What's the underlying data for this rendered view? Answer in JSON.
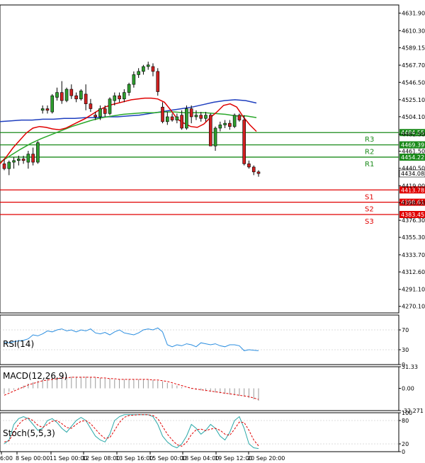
{
  "chart_data": {
    "type": "candlestick",
    "main": {
      "y_range": [
        4262,
        4642
      ],
      "ticks": [
        "4631.90",
        "4610.30",
        "4589.15",
        "4567.70",
        "4546.50",
        "4525.10",
        "4504.10",
        "4482.50",
        "4461.50",
        "4440.50",
        "4419.00",
        "4398.00",
        "4376.30",
        "4355.30",
        "4333.70",
        "4312.60",
        "4291.10",
        "4270.10"
      ],
      "candles": [
        {
          "o": 4446,
          "h": 4452,
          "l": 4438,
          "c": 4440
        },
        {
          "o": 4440,
          "h": 4450,
          "l": 4432,
          "c": 4448
        },
        {
          "o": 4448,
          "h": 4454,
          "l": 4440,
          "c": 4450
        },
        {
          "o": 4450,
          "h": 4456,
          "l": 4444,
          "c": 4452
        },
        {
          "o": 4452,
          "h": 4456,
          "l": 4446,
          "c": 4450
        },
        {
          "o": 4448,
          "h": 4462,
          "l": 4440,
          "c": 4458
        },
        {
          "o": 4458,
          "h": 4466,
          "l": 4444,
          "c": 4448
        },
        {
          "o": 4448,
          "h": 4474,
          "l": 4446,
          "c": 4472
        },
        {
          "o": 4512,
          "h": 4518,
          "l": 4508,
          "c": 4514
        },
        {
          "o": 4514,
          "h": 4518,
          "l": 4508,
          "c": 4512
        },
        {
          "o": 4510,
          "h": 4532,
          "l": 4508,
          "c": 4530
        },
        {
          "o": 4528,
          "h": 4540,
          "l": 4524,
          "c": 4534
        },
        {
          "o": 4534,
          "h": 4548,
          "l": 4520,
          "c": 4524
        },
        {
          "o": 4524,
          "h": 4540,
          "l": 4522,
          "c": 4538
        },
        {
          "o": 4538,
          "h": 4544,
          "l": 4526,
          "c": 4530
        },
        {
          "o": 4530,
          "h": 4534,
          "l": 4522,
          "c": 4526
        },
        {
          "o": 4526,
          "h": 4538,
          "l": 4524,
          "c": 4536
        },
        {
          "o": 4532,
          "h": 4544,
          "l": 4512,
          "c": 4520
        },
        {
          "o": 4520,
          "h": 4526,
          "l": 4510,
          "c": 4514
        },
        {
          "o": 4506,
          "h": 4510,
          "l": 4500,
          "c": 4504
        },
        {
          "o": 4504,
          "h": 4518,
          "l": 4500,
          "c": 4514
        },
        {
          "o": 4514,
          "h": 4518,
          "l": 4504,
          "c": 4508
        },
        {
          "o": 4508,
          "h": 4528,
          "l": 4506,
          "c": 4526
        },
        {
          "o": 4524,
          "h": 4534,
          "l": 4518,
          "c": 4530
        },
        {
          "o": 4530,
          "h": 4534,
          "l": 4522,
          "c": 4526
        },
        {
          "o": 4526,
          "h": 4538,
          "l": 4522,
          "c": 4534
        },
        {
          "o": 4534,
          "h": 4546,
          "l": 4530,
          "c": 4544
        },
        {
          "o": 4544,
          "h": 4560,
          "l": 4540,
          "c": 4556
        },
        {
          "o": 4556,
          "h": 4564,
          "l": 4552,
          "c": 4560
        },
        {
          "o": 4560,
          "h": 4568,
          "l": 4556,
          "c": 4566
        },
        {
          "o": 4566,
          "h": 4572,
          "l": 4562,
          "c": 4568
        },
        {
          "o": 4566,
          "h": 4570,
          "l": 4554,
          "c": 4560
        },
        {
          "o": 4560,
          "h": 4564,
          "l": 4530,
          "c": 4535
        },
        {
          "o": 4516,
          "h": 4522,
          "l": 4496,
          "c": 4498
        },
        {
          "o": 4498,
          "h": 4510,
          "l": 4494,
          "c": 4504
        },
        {
          "o": 4504,
          "h": 4508,
          "l": 4498,
          "c": 4500
        },
        {
          "o": 4500,
          "h": 4508,
          "l": 4496,
          "c": 4504
        },
        {
          "o": 4506,
          "h": 4512,
          "l": 4488,
          "c": 4490
        },
        {
          "o": 4490,
          "h": 4518,
          "l": 4488,
          "c": 4514
        },
        {
          "o": 4514,
          "h": 4518,
          "l": 4496,
          "c": 4504
        },
        {
          "o": 4504,
          "h": 4512,
          "l": 4500,
          "c": 4506
        },
        {
          "o": 4506,
          "h": 4510,
          "l": 4498,
          "c": 4502
        },
        {
          "o": 4502,
          "h": 4510,
          "l": 4498,
          "c": 4506
        },
        {
          "o": 4506,
          "h": 4508,
          "l": 4470,
          "c": 4468
        },
        {
          "o": 4468,
          "h": 4492,
          "l": 4462,
          "c": 4490
        },
        {
          "o": 4490,
          "h": 4498,
          "l": 4486,
          "c": 4494
        },
        {
          "o": 4494,
          "h": 4500,
          "l": 4490,
          "c": 4496
        },
        {
          "o": 4496,
          "h": 4500,
          "l": 4488,
          "c": 4492
        },
        {
          "o": 4492,
          "h": 4508,
          "l": 4490,
          "c": 4506
        },
        {
          "o": 4506,
          "h": 4508,
          "l": 4498,
          "c": 4500
        },
        {
          "o": 4500,
          "h": 4506,
          "l": 4444,
          "c": 4446
        },
        {
          "o": 4446,
          "h": 4450,
          "l": 4440,
          "c": 4442
        },
        {
          "o": 4442,
          "h": 4444,
          "l": 4432,
          "c": 4436
        },
        {
          "o": 4436,
          "h": 4438,
          "l": 4430,
          "c": 4434
        }
      ],
      "ma_red": [
        4446,
        4455,
        4466,
        4475,
        4484,
        4490,
        4492,
        4491,
        4489,
        4488,
        4490,
        4494,
        4498,
        4502,
        4507,
        4512,
        4516,
        4519,
        4521,
        4523,
        4525,
        4526,
        4527,
        4527,
        4526,
        4522,
        4512,
        4501,
        4496,
        4492,
        4491,
        4495,
        4503,
        4510,
        4518,
        4520,
        4516,
        4504,
        4494,
        4486
      ],
      "ma_blue": [
        4498,
        4499,
        4500,
        4500,
        4501,
        4501,
        4502,
        4502,
        4503,
        4503,
        4504,
        4504,
        4505,
        4506,
        4508,
        4510,
        4512,
        4514,
        4516,
        4519,
        4522,
        4524,
        4525,
        4524,
        4521
      ],
      "ma_green": [
        4448,
        4456,
        4464,
        4471,
        4477,
        4482,
        4487,
        4492,
        4496,
        4500,
        4503,
        4505,
        4507,
        4508,
        4509,
        4509,
        4510,
        4510,
        4509,
        4509,
        4509,
        4508,
        4507,
        4505,
        4505,
        4503
      ],
      "levels": [
        {
          "name": "R3",
          "label": "4484.55",
          "value": 4484.55,
          "color": "#1a8a1a"
        },
        {
          "name": "R2",
          "label": "4469.39",
          "value": 4469.39,
          "color": "#1a8a1a"
        },
        {
          "name": "R1",
          "label": "4454.22",
          "value": 4454.22,
          "color": "#1a8a1a"
        },
        {
          "name": "S1",
          "label": "4413.78",
          "value": 4413.78,
          "color": "#e00000"
        },
        {
          "name": "S2",
          "label": "4398.61",
          "value": 4398.61,
          "color": "#e00000"
        },
        {
          "name": "S3",
          "label": "4383.45",
          "value": 4383.45,
          "color": "#e00000"
        }
      ],
      "current": {
        "label": "4434.08",
        "value": 4434.08
      }
    },
    "rsi": {
      "title": "RSI(14)",
      "ticks": [
        {
          "label": "70",
          "value": 70
        },
        {
          "label": "30",
          "value": 30
        },
        {
          "label": "0",
          "value": 0
        }
      ],
      "values": [
        45,
        44,
        46,
        48,
        49,
        52,
        60,
        58,
        62,
        68,
        66,
        70,
        72,
        68,
        70,
        66,
        70,
        68,
        72,
        64,
        62,
        65,
        60,
        66,
        70,
        64,
        62,
        60,
        64,
        70,
        72,
        70,
        74,
        66,
        40,
        36,
        40,
        38,
        42,
        40,
        36,
        44,
        42,
        40,
        42,
        38,
        36,
        40,
        40,
        38,
        28,
        30,
        29,
        28
      ]
    },
    "macd": {
      "title": "MACD(12,26,9)",
      "ticks": [
        {
          "label": "31.33",
          "value": 31.33
        },
        {
          "label": "0.00",
          "value": 0
        },
        {
          "label": "-32.271",
          "value": -32.271
        }
      ],
      "values": [
        -8,
        -5,
        -2,
        1,
        4,
        7,
        9,
        11,
        13,
        14,
        15,
        16,
        17,
        17,
        17,
        17,
        17,
        17,
        16,
        16,
        15,
        14,
        14,
        13,
        13,
        13,
        13,
        13,
        13,
        13,
        13,
        12,
        11,
        10,
        8,
        6,
        4,
        2,
        0,
        -1,
        -2,
        -3,
        -4,
        -5,
        -6,
        -7,
        -8,
        -9,
        -10,
        -11,
        -12,
        -14,
        -16,
        -18
      ],
      "signal": [
        -10,
        -7,
        -4,
        -1,
        2,
        5,
        7,
        9,
        11,
        12,
        13,
        14,
        15,
        15,
        16,
        16,
        16,
        16,
        16,
        16,
        15,
        15,
        14,
        14,
        13,
        13,
        13,
        13,
        13,
        13,
        13,
        12,
        12,
        11,
        10,
        8,
        6,
        4,
        2,
        0,
        -1,
        -2,
        -3,
        -4,
        -5,
        -6,
        -7,
        -8,
        -9,
        -10,
        -11,
        -12,
        -14,
        -16
      ]
    },
    "stoch": {
      "title": "Stoch(5,5,3)",
      "ticks": [
        {
          "label": "100",
          "value": 100
        },
        {
          "label": "80",
          "value": 80
        },
        {
          "label": "20",
          "value": 20
        },
        {
          "label": "0",
          "value": 0
        }
      ],
      "k": [
        20,
        30,
        70,
        85,
        90,
        85,
        70,
        55,
        60,
        80,
        85,
        75,
        60,
        50,
        65,
        80,
        88,
        80,
        60,
        40,
        30,
        25,
        45,
        80,
        90,
        95,
        95,
        95,
        95,
        95,
        95,
        90,
        70,
        40,
        25,
        15,
        10,
        20,
        40,
        70,
        60,
        45,
        55,
        70,
        60,
        40,
        30,
        50,
        80,
        90,
        60,
        20,
        10,
        8
      ],
      "d": [
        25,
        28,
        50,
        70,
        82,
        86,
        80,
        68,
        62,
        70,
        78,
        80,
        72,
        62,
        60,
        70,
        78,
        80,
        72,
        58,
        44,
        34,
        36,
        55,
        75,
        88,
        93,
        94,
        95,
        95,
        95,
        93,
        85,
        65,
        45,
        30,
        18,
        14,
        24,
        44,
        56,
        58,
        54,
        58,
        60,
        55,
        45,
        42,
        58,
        76,
        75,
        55,
        30,
        15
      ]
    },
    "x_labels": [
      "6:00",
      "8 Sep 00:00",
      "11 Sep 00:00",
      "12 Sep 08:00",
      "13 Sep 16:00",
      "15 Sep 00:00",
      "18 Sep 04:00",
      "19 Sep 12:00",
      "20 Sep 20:00"
    ]
  }
}
